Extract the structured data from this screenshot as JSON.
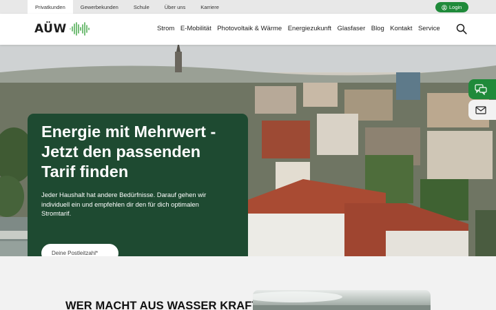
{
  "topbar": {
    "items": [
      {
        "label": "Privatkunden",
        "active": true
      },
      {
        "label": "Gewerbekunden",
        "active": false
      },
      {
        "label": "Schule",
        "active": false
      },
      {
        "label": "Über uns",
        "active": false
      },
      {
        "label": "Karriere",
        "active": false
      }
    ],
    "login_label": "Login",
    "login_icon": "user-icon"
  },
  "header": {
    "logo_text": "AÜW",
    "logo_icon": "wave-bars-icon",
    "nav": [
      "Strom",
      "E-Mobilität",
      "Photovoltaik & Wärme",
      "Energiezukunft",
      "Glasfaser",
      "Blog",
      "Kontakt",
      "Service"
    ],
    "search_icon": "search-icon"
  },
  "hero": {
    "title": "Energie mit Mehrwert - Jetzt den passenden Tarif finden",
    "text": "Jeder Haushalt hat andere Bedürfnisse. Darauf gehen wir individuell ein und empfehlen dir den für dich optimalen Stromtarif.",
    "postcode_placeholder": "Deine Postleitzahl*"
  },
  "side_buttons": [
    {
      "icon": "chat-bubbles-icon"
    },
    {
      "icon": "mail-icon"
    }
  ],
  "section": {
    "heading": "WER MACHT AUS WASSER KRAFT"
  },
  "colors": {
    "brand_green": "#1f8a3a",
    "card_green": "#1e4a31",
    "topbar_bg": "#e8e8e8",
    "section_bg": "#f2f2f2"
  }
}
